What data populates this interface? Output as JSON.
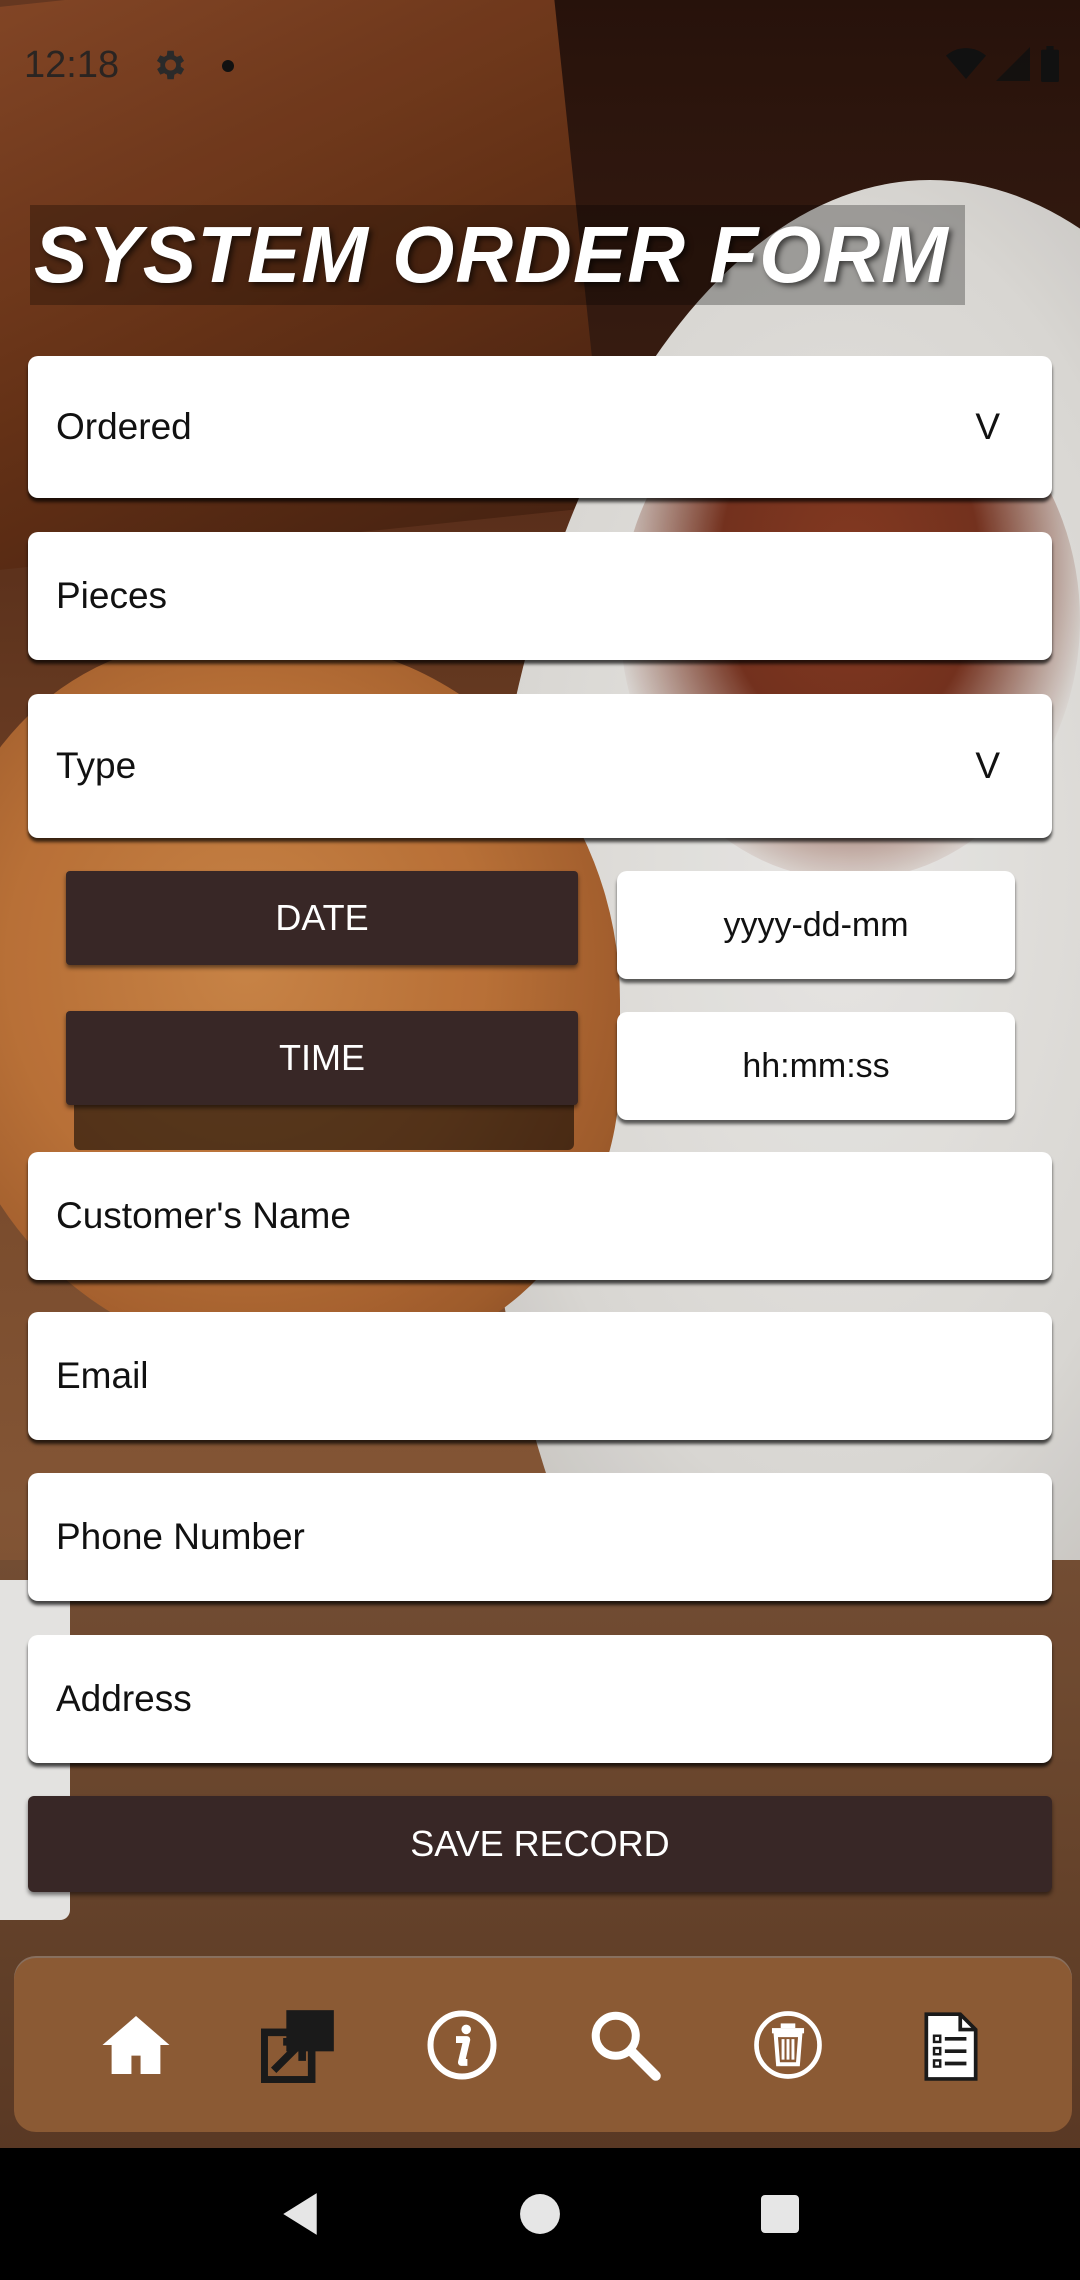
{
  "status_bar": {
    "time": "12:18"
  },
  "form": {
    "title": "SYSTEM ORDER FORM",
    "ordered": {
      "label": "Ordered",
      "dropdown_indicator": "V"
    },
    "pieces": {
      "placeholder": "Pieces"
    },
    "type": {
      "label": "Type",
      "dropdown_indicator": "V"
    },
    "date_button": "DATE",
    "date_value": "yyyy-dd-mm",
    "time_button": "TIME",
    "time_value": "hh:mm:ss",
    "customer_name": {
      "placeholder": "Customer's Name"
    },
    "email": {
      "placeholder": "Email"
    },
    "phone": {
      "placeholder": "Phone Number"
    },
    "address": {
      "placeholder": "Address"
    },
    "save_button": "SAVE RECORD"
  },
  "bottom_nav": {
    "items": [
      {
        "icon": "home-icon"
      },
      {
        "icon": "open-external-icon"
      },
      {
        "icon": "info-icon"
      },
      {
        "icon": "search-icon"
      },
      {
        "icon": "trash-icon"
      },
      {
        "icon": "clipboard-list-icon"
      }
    ],
    "background_color": "#8b5a34"
  },
  "colors": {
    "dark_button": "#382726",
    "field_background": "#ffffff"
  }
}
